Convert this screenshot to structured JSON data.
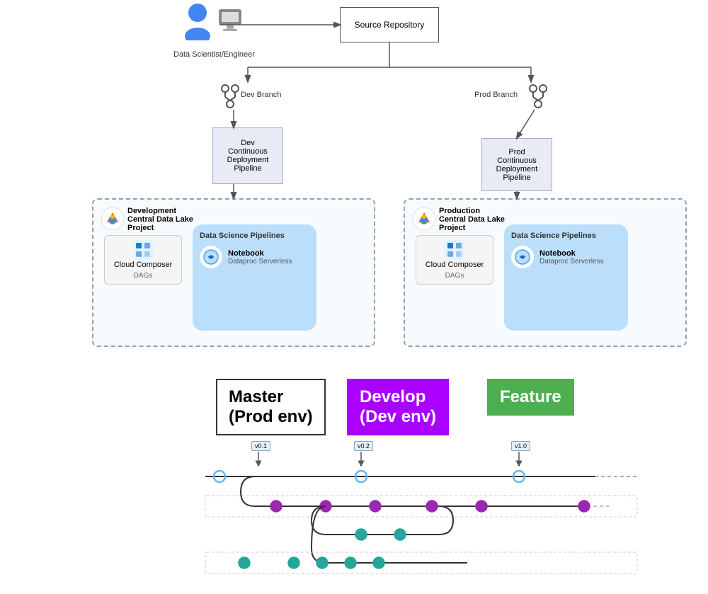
{
  "diagram": {
    "source_repo": "Source Repository",
    "person_label": "Data Scientist/Engineer",
    "dev_branch": "Dev Branch",
    "prod_branch": "Prod Branch",
    "dev_pipeline": "Dev\nContinuous\nDeployment\nPipeline",
    "prod_pipeline": "Prod\nContinuous\nDeployment\nPipeline",
    "dev_project_title": "Development\nCentral Data Lake\nProject",
    "prod_project_title": "Production\nCentral Data Lake\nProject",
    "pipelines_title": "Data Science Pipelines",
    "cloud_composer": "Cloud\nComposer",
    "dags": "DAGs",
    "notebook": "Notebook",
    "dataproc": "Dataproc Serverless"
  },
  "git": {
    "master_label": "Master\n(Prod env)",
    "develop_label": "Develop\n(Dev env)",
    "feature_label": "Feature",
    "v01": "v0.1",
    "v02": "v0.2",
    "v10": "v1.0"
  }
}
